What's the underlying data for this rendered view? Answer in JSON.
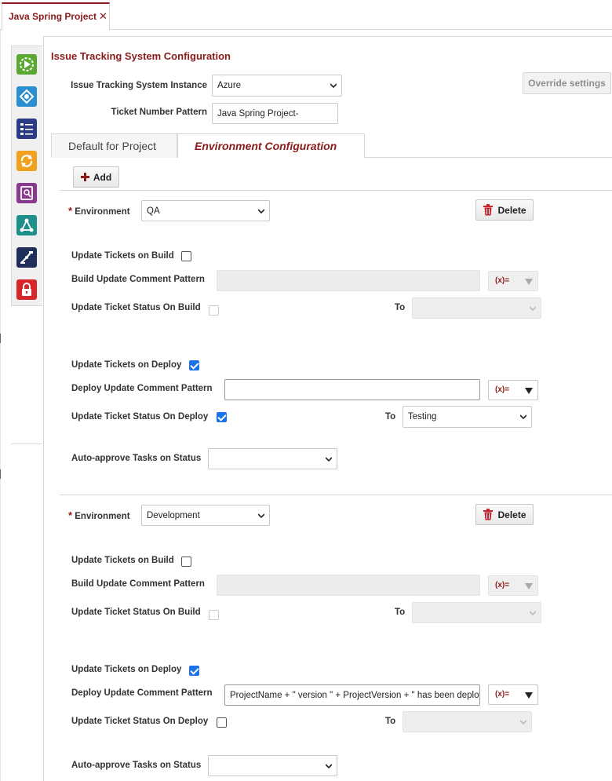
{
  "project_tab": {
    "label": "Java Spring Project",
    "close": "✕"
  },
  "title": "Issue Tracking System Configuration",
  "its": {
    "instance_label": "Issue Tracking System Instance",
    "instance_value": "Azure",
    "pattern_label": "Ticket Number Pattern",
    "pattern_value": "Java Spring Project-",
    "override_label": "Override settings"
  },
  "tabs": {
    "default": "Default for Project",
    "environment": "Environment Configuration"
  },
  "add_label": "Add",
  "delete_label": "Delete",
  "var_label": "(x)=",
  "labels": {
    "environment": "Environment",
    "update_build": "Update Tickets on Build",
    "build_comment": "Build Update Comment Pattern",
    "status_build": "Update Ticket Status On Build",
    "to": "To",
    "update_deploy": "Update Tickets on Deploy",
    "deploy_comment": "Deploy Update Comment Pattern",
    "status_deploy": "Update Ticket Status On Deploy",
    "auto_approve": "Auto-approve Tasks on Status"
  },
  "environments": [
    {
      "name": "QA",
      "update_build": false,
      "build_comment": "",
      "status_build": false,
      "build_to": "",
      "update_deploy": true,
      "deploy_comment": "",
      "status_deploy": true,
      "deploy_to": "Testing",
      "auto_approve": ""
    },
    {
      "name": "Development",
      "update_build": false,
      "build_comment": "",
      "status_build": false,
      "build_to": "",
      "update_deploy": true,
      "deploy_comment": "ProjectName + \" version \" + ProjectVersion + \" has been deploy",
      "status_deploy": false,
      "deploy_to": "",
      "auto_approve": ""
    }
  ],
  "icons": [
    "run-icon",
    "deploy-icon",
    "checklist-icon",
    "sync-icon",
    "report-icon",
    "workflow-icon",
    "robot-icon",
    "lock-icon"
  ]
}
